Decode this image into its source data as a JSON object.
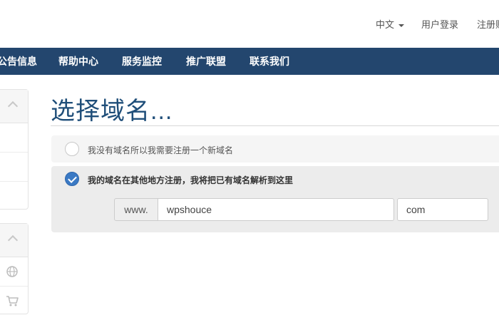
{
  "header": {
    "language_label": "中文",
    "login_label": "用户登录",
    "register_label": "注册账户"
  },
  "nav": {
    "items": [
      {
        "label": "公告信息"
      },
      {
        "label": "帮助中心"
      },
      {
        "label": "服务监控"
      },
      {
        "label": "推广联盟"
      },
      {
        "label": "联系我们"
      }
    ]
  },
  "sidebar": {
    "icons": [
      "chevron-up-icon",
      "globe-icon",
      "cart-icon"
    ]
  },
  "main": {
    "title": "选择域名...",
    "options": [
      {
        "label": "我没有域名所以我需要注册一个新域名",
        "selected": false
      },
      {
        "label": "我的域名在其他地方注册，我将把已有域名解析到这里",
        "selected": true
      }
    ],
    "domain_form": {
      "prefix": "www.",
      "domain_value": "wpshouce",
      "tld_value": "com"
    }
  },
  "colors": {
    "nav_background": "#23466e",
    "title": "#1f4e79",
    "radio_checked": "#3a79c4"
  }
}
